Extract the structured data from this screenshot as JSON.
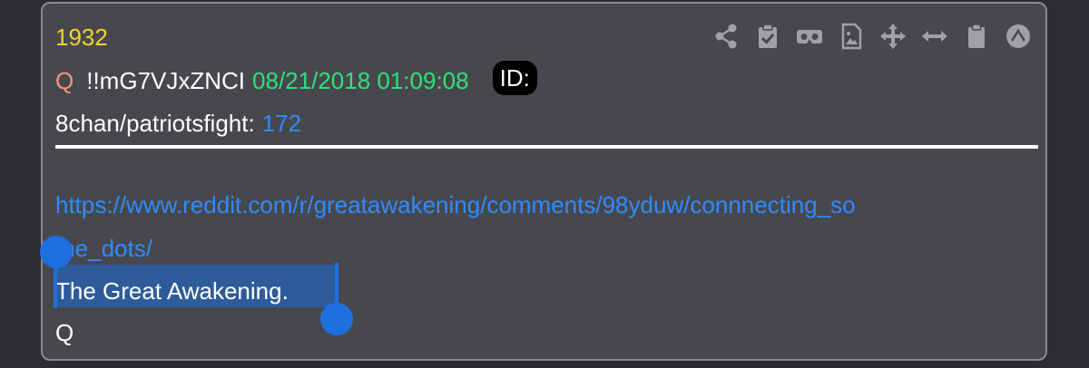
{
  "post": {
    "number": "1932",
    "name": "Q",
    "tripcode": "!!mG7VJxZNCI",
    "timestamp": "08/21/2018 01:09:08",
    "id_label": "ID:",
    "board": "8chan/patriotsfight:",
    "post_count": "172",
    "link_line1": "https://www.reddit.com/r/greatawakening/comments/98yduw/connnecting_so",
    "link_line2": "me_dots/",
    "body_text": "The Great Awakening.",
    "signature": "Q"
  },
  "toolbar": {
    "icons": [
      "share-icon",
      "clipboard-check-icon",
      "vr-headset-icon",
      "image-file-icon",
      "move-icon",
      "expand-horizontal-icon",
      "clipboard-icon",
      "up-arrow-icon"
    ]
  },
  "colors": {
    "background": "#2b2c31",
    "card": "#47484d",
    "number": "#f5d02e",
    "name": "#f0937a",
    "timestamp": "#2fe07a",
    "link": "#2f8bff",
    "selection": "#2663b5"
  }
}
